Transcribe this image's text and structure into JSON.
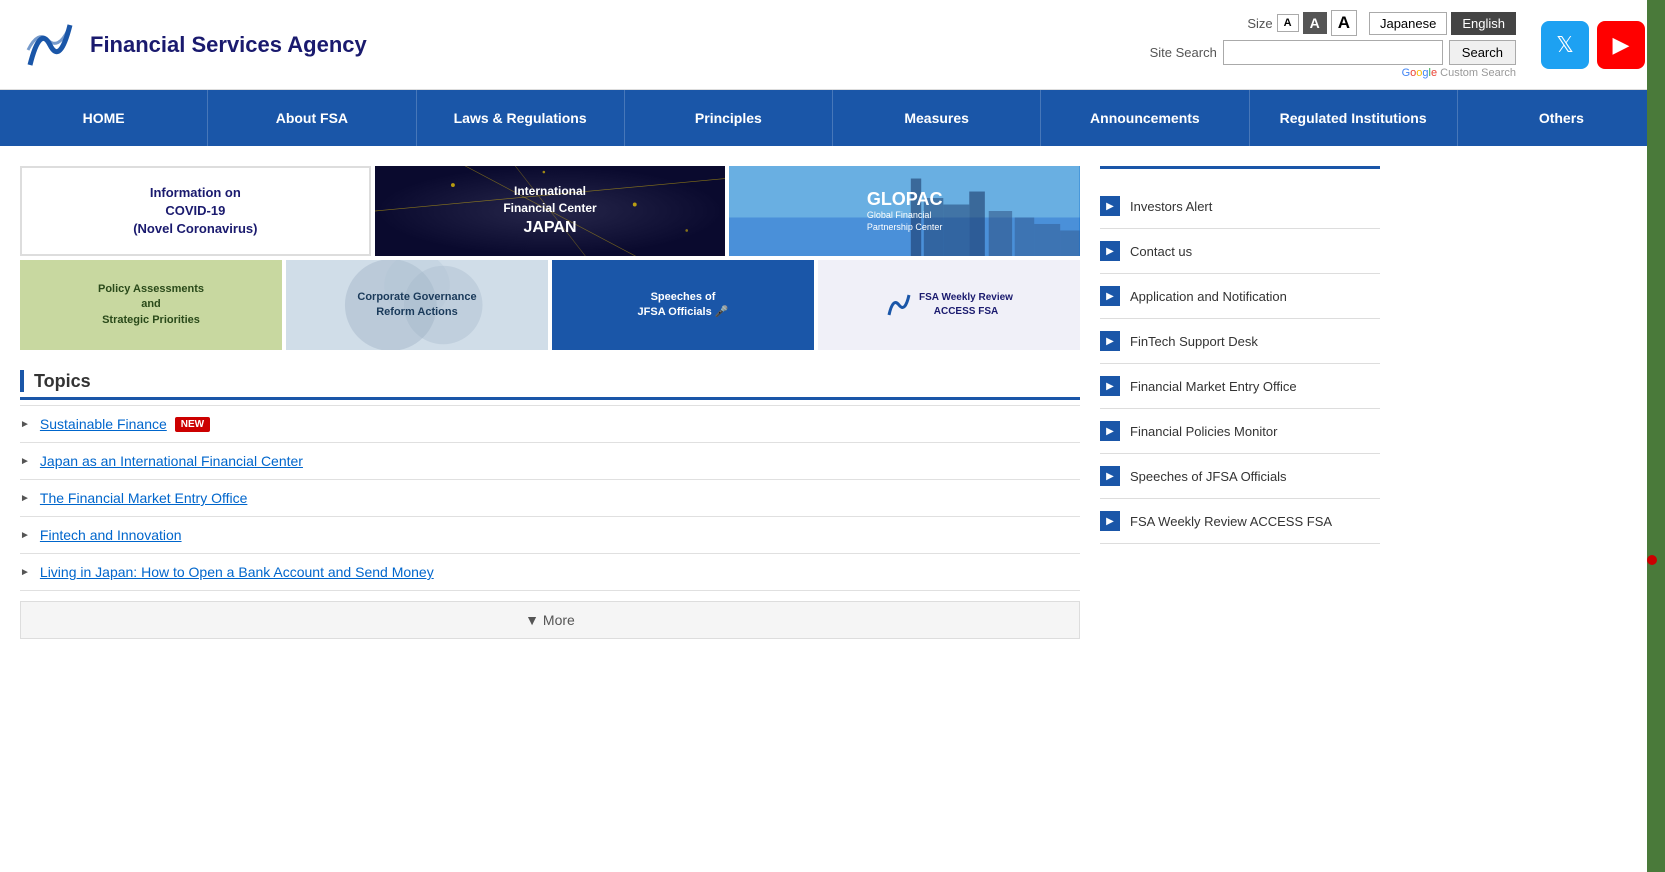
{
  "header": {
    "logo_text": "Financial Services Agency",
    "size_label": "Size",
    "size_small": "A",
    "size_medium": "A",
    "size_large": "A",
    "lang_japanese": "Japanese",
    "lang_english": "English",
    "search_label": "Site Search",
    "search_placeholder": "",
    "search_button": "Search",
    "google_label": "Google Custom Search"
  },
  "nav": {
    "items": [
      {
        "id": "home",
        "label": "HOME"
      },
      {
        "id": "about",
        "label": "About FSA"
      },
      {
        "id": "laws",
        "label": "Laws & Regulations"
      },
      {
        "id": "principles",
        "label": "Principles"
      },
      {
        "id": "measures",
        "label": "Measures"
      },
      {
        "id": "announcements",
        "label": "Announcements"
      },
      {
        "id": "regulated",
        "label": "Regulated Institutions"
      },
      {
        "id": "others",
        "label": "Others"
      }
    ]
  },
  "banners": {
    "top": [
      {
        "id": "covid",
        "line1": "Information on",
        "line2": "COVID-19",
        "line3": "(Novel Coronavirus)"
      },
      {
        "id": "ifcj",
        "line1": "International",
        "line2": "Financial Center",
        "line3": "JAPAN"
      },
      {
        "id": "glopac",
        "title": "GLOPAC",
        "sub1": "Global Financial",
        "sub2": "Partnership Center"
      }
    ],
    "bottom": [
      {
        "id": "policy",
        "line1": "Policy Assessments",
        "line2": "and",
        "line3": "Strategic Priorities"
      },
      {
        "id": "corp",
        "line1": "Corporate Governance",
        "line2": "Reform Actions"
      },
      {
        "id": "speeches",
        "line1": "Speeches of",
        "line2": "JFSA Officials 🎤"
      },
      {
        "id": "fsa-review",
        "line1": "FSA Weekly Review",
        "line2": "ACCESS FSA"
      }
    ]
  },
  "topics": {
    "title": "Topics",
    "items": [
      {
        "id": "sustainable",
        "text": "Sustainable Finance",
        "is_new": true
      },
      {
        "id": "intl-center",
        "text": "Japan as an International Financial Center",
        "is_new": false
      },
      {
        "id": "market-entry",
        "text": "The Financial Market Entry Office",
        "is_new": false
      },
      {
        "id": "fintech",
        "text": "Fintech and Innovation",
        "is_new": false
      },
      {
        "id": "living",
        "text": "Living in Japan: How to Open a Bank Account and Send Money",
        "is_new": false
      }
    ],
    "more_label": "▼ More",
    "new_badge": "NEW"
  },
  "sidebar": {
    "items": [
      {
        "id": "investors-alert",
        "label": "Investors Alert"
      },
      {
        "id": "contact-us",
        "label": "Contact us"
      },
      {
        "id": "application",
        "label": "Application and Notification"
      },
      {
        "id": "fintech",
        "label": "FinTech Support Desk"
      },
      {
        "id": "financial-market",
        "label": "Financial Market Entry Office"
      },
      {
        "id": "financial-policies",
        "label": "Financial Policies Monitor"
      },
      {
        "id": "speeches",
        "label": "Speeches of JFSA Officials"
      },
      {
        "id": "fsa-review",
        "label": "FSA Weekly Review ACCESS FSA"
      }
    ]
  }
}
